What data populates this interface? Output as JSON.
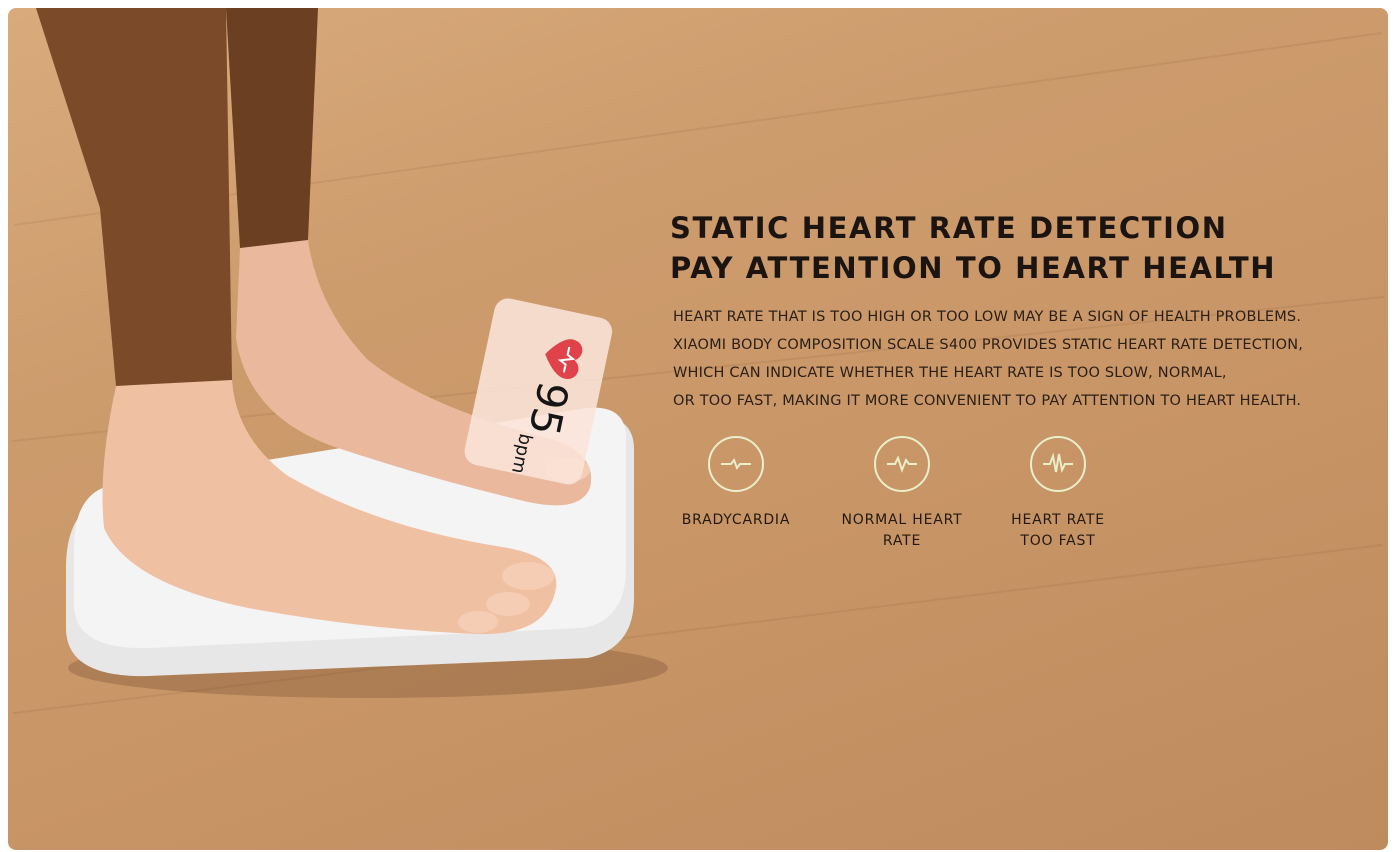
{
  "headline": {
    "line1": "STATIC HEART RATE DETECTION",
    "line2": "PAY ATTENTION TO HEART HEALTH"
  },
  "body": {
    "lines": [
      "HEART RATE THAT IS TOO HIGH OR TOO LOW MAY BE A SIGN OF HEALTH PROBLEMS.",
      "XIAOMI BODY COMPOSITION SCALE S400 PROVIDES STATIC HEART RATE DETECTION,",
      "WHICH CAN INDICATE WHETHER THE HEART RATE IS TOO SLOW, NORMAL,",
      "OR TOO FAST, MAKING IT MORE CONVENIENT TO PAY ATTENTION TO HEART HEALTH."
    ]
  },
  "heart_card": {
    "value": "95",
    "unit": "bpm",
    "icon": "heart-icon",
    "accent": "#e0424a"
  },
  "categories": [
    {
      "line1": "BRADYCARDIA",
      "line2": "",
      "icon": "pulse-slow-icon"
    },
    {
      "line1": "NORMAL HEART",
      "line2": "RATE",
      "icon": "pulse-normal-icon"
    },
    {
      "line1": "HEART RATE",
      "line2": "TOO FAST",
      "icon": "pulse-fast-icon"
    }
  ],
  "colors": {
    "floor": "#cd9c6d",
    "text": "#1b1410",
    "icon_ring": "#e9efc9"
  }
}
